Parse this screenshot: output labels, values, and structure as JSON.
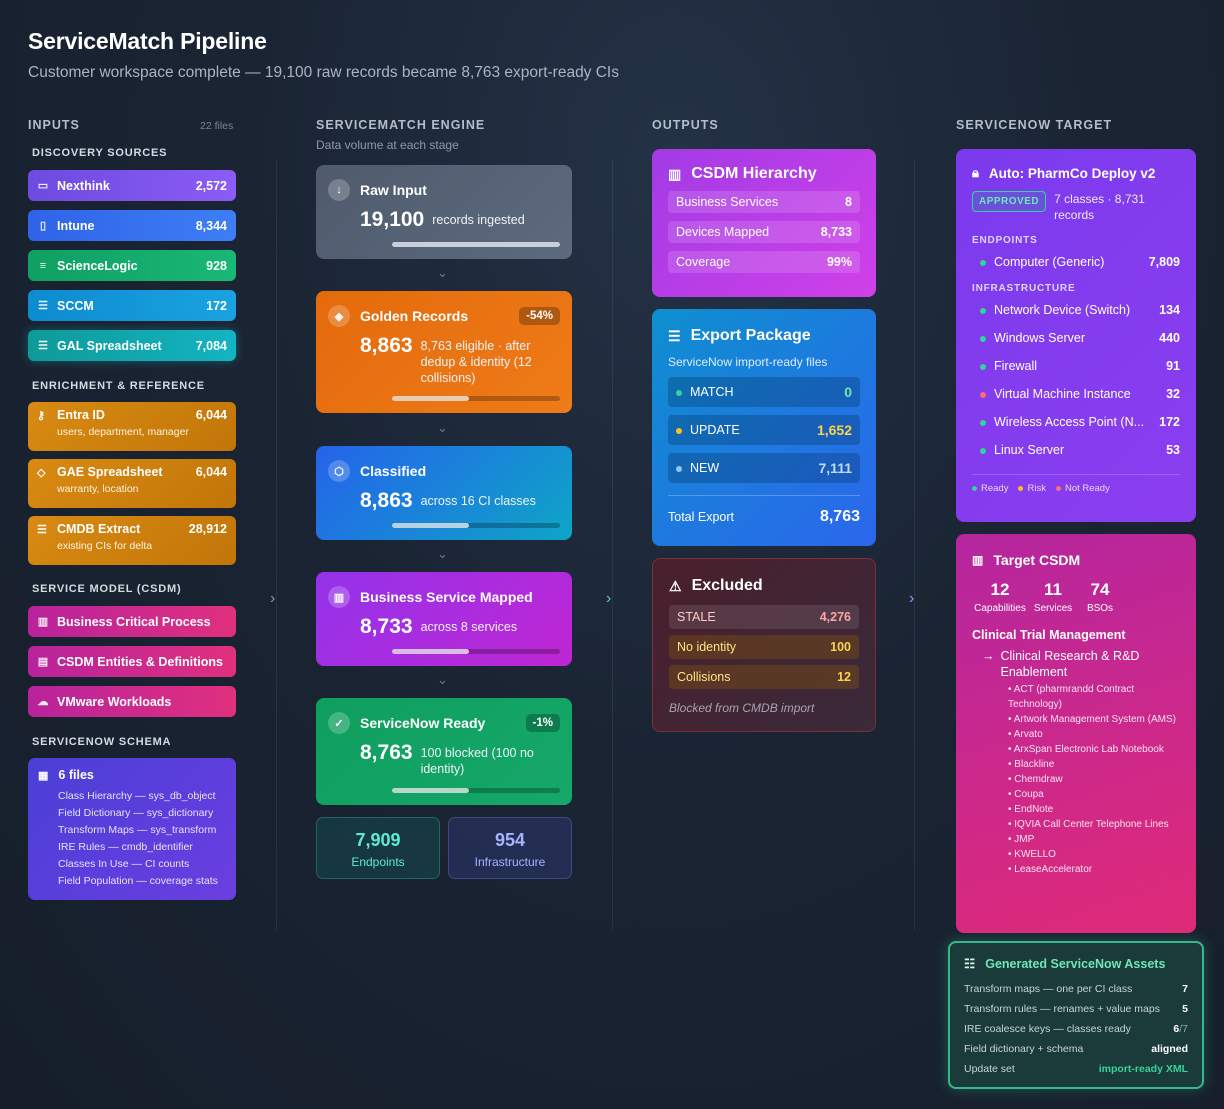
{
  "header": {
    "title": "ServiceMatch Pipeline",
    "subtitle": "Customer workspace complete — 19,100 raw records became 8,763 export-ready CIs"
  },
  "inputs": {
    "heading": "INPUTS",
    "file_count": "22 files",
    "discovery_heading": "DISCOVERY SOURCES",
    "discovery": [
      {
        "label": "Nexthink",
        "count": "2,572",
        "icon": "monitor-icon",
        "color": "#7c4ddf"
      },
      {
        "label": "Intune",
        "count": "8,344",
        "icon": "phone-icon",
        "color": "#3b6ff0"
      },
      {
        "label": "ScienceLogic",
        "count": "928",
        "icon": "server-icon",
        "color": "#14a86a"
      },
      {
        "label": "SCCM",
        "count": "172",
        "icon": "database-icon",
        "color": "#1592d6"
      },
      {
        "label": "GAL Spreadsheet",
        "count": "7,084",
        "icon": "database-icon",
        "color": "#12a3a8"
      }
    ],
    "enrichment_heading": "ENRICHMENT & REFERENCE",
    "enrichment": [
      {
        "label": "Entra ID",
        "count": "6,044",
        "sub": "users, department, manager",
        "icon": "key-icon"
      },
      {
        "label": "GAE Spreadsheet",
        "count": "6,044",
        "sub": "warranty, location",
        "icon": "tag-icon"
      },
      {
        "label": "CMDB Extract",
        "count": "28,912",
        "sub": "existing CIs for delta",
        "icon": "database-icon"
      }
    ],
    "csdm_heading": "SERVICE MODEL (CSDM)",
    "csdm": [
      {
        "label": "Business Critical Process",
        "icon": "building-icon"
      },
      {
        "label": "CSDM Entities & Definitions",
        "icon": "document-icon"
      },
      {
        "label": "VMware Workloads",
        "icon": "cloud-icon"
      }
    ],
    "schema_heading": "SERVICENOW SCHEMA",
    "schema": {
      "title": "6 files",
      "items": [
        "Class Hierarchy — sys_db_object",
        "Field Dictionary — sys_dictionary",
        "Transform Maps — sys_transform",
        "IRE Rules — cmdb_identifier",
        "Classes In Use — CI counts",
        "Field Population — coverage stats"
      ]
    }
  },
  "engine": {
    "heading": "SERVICEMATCH ENGINE",
    "subheading": "Data volume at each stage",
    "stages": [
      {
        "title": "Raw Input",
        "value": "19,100",
        "desc": "records ingested",
        "badge": "",
        "progress": 1.0
      },
      {
        "title": "Golden Records",
        "value": "8,863",
        "desc": "8,763 eligible · after dedup & identity (12 collisions)",
        "badge": "-54%",
        "progress": 0.46
      },
      {
        "title": "Classified",
        "value": "8,863",
        "desc": "across 16 CI classes",
        "badge": "",
        "progress": 0.46
      },
      {
        "title": "Business Service Mapped",
        "value": "8,733",
        "desc": "across 8 services",
        "badge": "",
        "progress": 0.46
      },
      {
        "title": "ServiceNow Ready",
        "value": "8,763",
        "desc": "100 blocked (100 no identity)",
        "badge": "-1%",
        "progress": 0.46
      }
    ],
    "endpoints": {
      "value": "7,909",
      "label": "Endpoints"
    },
    "infrastructure": {
      "value": "954",
      "label": "Infrastructure"
    }
  },
  "outputs": {
    "heading": "OUTPUTS",
    "csdm_hierarchy": {
      "title": "CSDM Hierarchy",
      "rows": [
        {
          "label": "Business Services",
          "value": "8"
        },
        {
          "label": "Devices Mapped",
          "value": "8,733"
        },
        {
          "label": "Coverage",
          "value": "99%"
        }
      ]
    },
    "export_package": {
      "title": "Export Package",
      "subtitle": "ServiceNow import-ready files",
      "rows": [
        {
          "label": "MATCH",
          "value": "0",
          "color": "#34d399"
        },
        {
          "label": "UPDATE",
          "value": "1,652",
          "color": "#fbbf24"
        },
        {
          "label": "NEW",
          "value": "7,111",
          "color": "#93c5fd"
        }
      ],
      "total_label": "Total Export",
      "total_value": "8,763"
    },
    "excluded": {
      "title": "Excluded",
      "rows": [
        {
          "label": "STALE",
          "value": "4,276"
        },
        {
          "label": "No identity",
          "value": "100"
        },
        {
          "label": "Collisions",
          "value": "12"
        }
      ],
      "note": "Blocked from CMDB import"
    }
  },
  "target": {
    "heading": "SERVICENOW TARGET",
    "deploy": {
      "title": "Auto: PharmCo Deploy v2",
      "status": "APPROVED",
      "summary": "7 classes · 8,731 records",
      "endpoints_heading": "ENDPOINTS",
      "endpoints": [
        {
          "label": "Computer (Generic)",
          "value": "7,809",
          "status": "ready"
        }
      ],
      "infra_heading": "INFRASTRUCTURE",
      "infra": [
        {
          "label": "Network Device (Switch)",
          "value": "134",
          "status": "ready"
        },
        {
          "label": "Windows Server",
          "value": "440",
          "status": "ready"
        },
        {
          "label": "Firewall",
          "value": "91",
          "status": "ready"
        },
        {
          "label": "Virtual Machine Instance",
          "value": "32",
          "status": "notready"
        },
        {
          "label": "Wireless Access Point (N...",
          "value": "172",
          "status": "ready"
        },
        {
          "label": "Linux Server",
          "value": "53",
          "status": "ready"
        }
      ],
      "legend": {
        "ready": "Ready",
        "risk": "Risk",
        "notready": "Not Ready"
      }
    },
    "target_csdm": {
      "title": "Target CSDM",
      "stats": [
        {
          "value": "12",
          "label": "Capabilities"
        },
        {
          "value": "11",
          "label": "Services"
        },
        {
          "value": "74",
          "label": "BSOs"
        }
      ],
      "group": "Clinical Trial Management",
      "subgroup": "Clinical Research & R&D Enablement",
      "apps": [
        "• ACT (pharmrandd Contract Technology)",
        "• Artwork Management System (AMS)",
        "• Arvato",
        "• ArxSpan Electronic Lab Notebook",
        "• Blackline",
        "• Chemdraw",
        "• Coupa",
        "• EndNote",
        "• IQVIA Call Center Telephone Lines",
        "• JMP",
        "• KWELLO",
        "• LeaseAccelerator"
      ]
    },
    "generated": {
      "title": "Generated ServiceNow Assets",
      "rows": [
        {
          "label": "Transform maps — one per CI class",
          "value": "7"
        },
        {
          "label": "Transform rules — renames + value maps",
          "value": "5"
        },
        {
          "label": "IRE coalesce keys — classes ready",
          "value": "6",
          "suffix": "/7"
        },
        {
          "label": "Field dictionary + schema",
          "value": "aligned"
        },
        {
          "label": "Update set",
          "value": "import-ready XML"
        }
      ]
    }
  },
  "colors": {
    "ready": "#34d399",
    "risk": "#fbbf24",
    "notready": "#f87171"
  }
}
